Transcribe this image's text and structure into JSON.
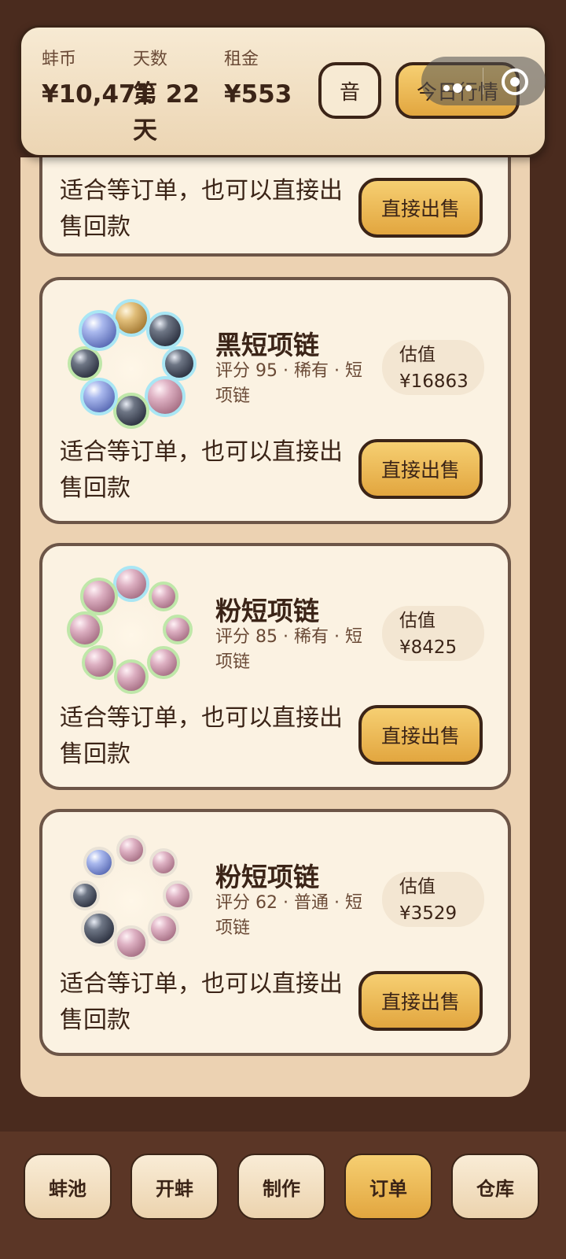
{
  "header": {
    "coins_label": "蚌币",
    "coins_value": "¥10,471",
    "days_label": "天数",
    "days_value": "第 22 天",
    "rent_label": "租金",
    "rent_value": "¥553",
    "sound_button": "音",
    "market_button": "今日行情"
  },
  "orders": [
    {
      "desc": "适合等订单，也可以直接出售回款",
      "sell_button": "直接出售"
    },
    {
      "name": "黑短项链",
      "meta": "评分 95 · 稀有 · 短项链",
      "price_label": "估值",
      "price_value": "¥16863",
      "desc": "适合等订单，也可以直接出售回款",
      "sell_button": "直接出售"
    },
    {
      "name": "粉短项链",
      "meta": "评分 85 · 稀有 · 短项链",
      "price_label": "估值",
      "price_value": "¥8425",
      "desc": "适合等订单，也可以直接出售回款",
      "sell_button": "直接出售"
    },
    {
      "name": "粉短项链",
      "meta": "评分 62 · 普通 · 短项链",
      "price_label": "估值",
      "price_value": "¥3529",
      "desc": "适合等订单，也可以直接出售回款",
      "sell_button": "直接出售"
    }
  ],
  "nav": {
    "items": [
      "蚌池",
      "开蚌",
      "制作",
      "订单",
      "仓库"
    ],
    "active": "订单"
  },
  "colors": {
    "background": "#4a2b1e",
    "card": "#fbf2e2",
    "button_gold": "#e9b24f",
    "text_dark": "#3b2417"
  }
}
